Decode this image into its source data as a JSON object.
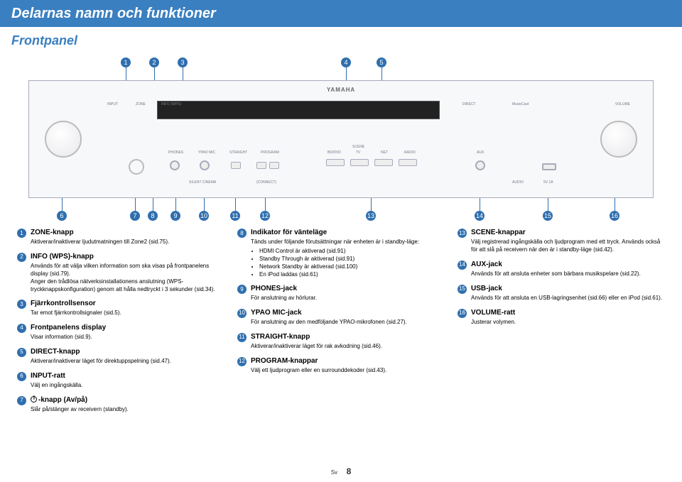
{
  "header": "Delarnas namn och funktioner",
  "subheader": "Frontpanel",
  "footer": {
    "lang": "Sv",
    "page": "8"
  },
  "panel": {
    "brand": "YAMAHA",
    "labels": {
      "input": "INPUT",
      "zone": "ZONE",
      "info": "INFO (WPS)",
      "direct": "DIRECT",
      "volume": "VOLUME",
      "phones": "PHONES",
      "ypao": "YPAO MIC",
      "straight": "STRAIGHT",
      "program": "PROGRAM",
      "scene": "SCENE",
      "bd": "BD/DVD",
      "tv": "TV",
      "net": "NET",
      "radio": "RADIO",
      "aux": "AUX",
      "silent": "SILENT CINEMA",
      "connect": "(CONNECT)",
      "audio": "AUDIO",
      "dc5v": "5V   1A",
      "musiccast": "MusicCast"
    }
  },
  "top_callouts": [
    "1",
    "2",
    "3",
    "4",
    "5"
  ],
  "bottom_callouts": [
    "6",
    "7",
    "8",
    "9",
    "10",
    "11",
    "12",
    "13",
    "14",
    "15",
    "16"
  ],
  "items": {
    "c1": [
      {
        "n": "1",
        "title": "ZONE-knapp",
        "desc": "Aktiverar/inaktiverar ljudutmatningen till Zone2 (sid.75)."
      },
      {
        "n": "2",
        "title": "INFO (WPS)-knapp",
        "desc": "Används för att välja vilken information som ska visas på frontpanelens display (sid.79).<br>Anger den trådlösa nätverksinstallationens anslutning (WPS-tryckknappskonfiguration) genom att hålla nedtryckt i 3 sekunder (sid.34)."
      },
      {
        "n": "3",
        "title": "Fjärrkontrollsensor",
        "desc": "Tar emot fjärrkontrollsignaler (sid.5)."
      },
      {
        "n": "4",
        "title": "Frontpanelens display",
        "desc": "Visar information (sid.9)."
      },
      {
        "n": "5",
        "title": "DIRECT-knapp",
        "desc": "Aktiverar/inaktiverar läget för direktuppspelning (sid.47)."
      },
      {
        "n": "6",
        "title": "INPUT-ratt",
        "desc": "Välj en ingångskälla."
      },
      {
        "n": "7",
        "title": "-knapp (Av/på)",
        "desc": "Slår på/stänger av receivern (standby).",
        "power": true
      }
    ],
    "c2": [
      {
        "n": "8",
        "title": "Indikator för vänteläge",
        "desc": "Tänds under följande förutsättningar när enheten är i standby-läge:",
        "bullets": [
          "HDMI Control är aktiverad (sid.91)",
          "Standby Through är aktiverad (sid.91)",
          "Network Standby är aktiverad (sid.100)",
          "En iPod laddas (sid.61)"
        ]
      },
      {
        "n": "9",
        "title": "PHONES-jack",
        "desc": "För anslutning av hörlurar."
      },
      {
        "n": "10",
        "title": "YPAO MIC-jack",
        "desc": "För anslutning av den medföljande YPAO-mikrofonen (sid.27)."
      },
      {
        "n": "11",
        "title": "STRAIGHT-knapp",
        "desc": "Aktiverar/inaktiverar läget för rak avkodning (sid.46)."
      },
      {
        "n": "12",
        "title": "PROGRAM-knappar",
        "desc": "Välj ett ljudprogram eller en surrounddekoder (sid.43)."
      }
    ],
    "c3": [
      {
        "n": "13",
        "title": "SCENE-knappar",
        "desc": "Välj registrerad ingångskälla och ljudprogram med ett tryck. Används också för att slå på receivern när den är i standby-läge (sid.42)."
      },
      {
        "n": "14",
        "title": "AUX-jack",
        "desc": "Används för att ansluta enheter som bärbara musikspelare (sid.22)."
      },
      {
        "n": "15",
        "title": "USB-jack",
        "desc": "Används för att ansluta en USB-lagringsenhet (sid.66) eller en iPod (sid.61)."
      },
      {
        "n": "16",
        "title": "VOLUME-ratt",
        "desc": "Justerar volymen."
      }
    ]
  }
}
